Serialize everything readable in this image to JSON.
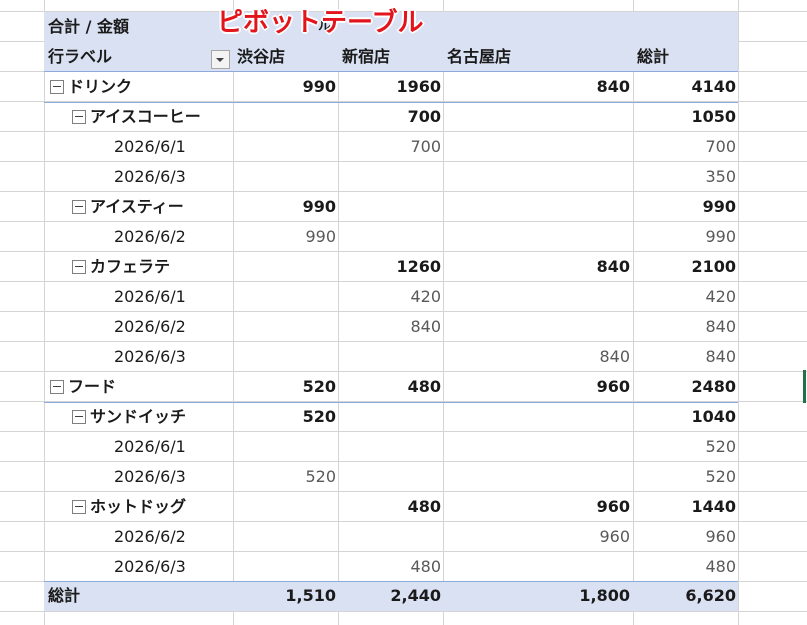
{
  "overlay_title": "ピボットテーブル",
  "header": {
    "value_label": "合計 / 金額",
    "row_label": "行ラベル",
    "col_label_fragment": "ル",
    "columns": [
      "渋谷店",
      "新宿店",
      "名古屋店",
      "総計"
    ]
  },
  "rows": [
    {
      "level": 0,
      "toggle": true,
      "label": "ドリンク",
      "bold": true,
      "values": [
        "990",
        "1960",
        "840",
        "4140"
      ]
    },
    {
      "level": 1,
      "toggle": true,
      "label": "アイスコーヒー",
      "bold": true,
      "values": [
        "",
        "700",
        "",
        "1050"
      ]
    },
    {
      "level": 2,
      "toggle": false,
      "label": "2026/6/1",
      "bold": false,
      "values": [
        "",
        "700",
        "",
        "700"
      ]
    },
    {
      "level": 2,
      "toggle": false,
      "label": "2026/6/3",
      "bold": false,
      "values": [
        "",
        "",
        "",
        "350"
      ]
    },
    {
      "level": 1,
      "toggle": true,
      "label": "アイスティー",
      "bold": true,
      "values": [
        "990",
        "",
        "",
        "990"
      ]
    },
    {
      "level": 2,
      "toggle": false,
      "label": "2026/6/2",
      "bold": false,
      "values": [
        "990",
        "",
        "",
        "990"
      ]
    },
    {
      "level": 1,
      "toggle": true,
      "label": "カフェラテ",
      "bold": true,
      "values": [
        "",
        "1260",
        "840",
        "2100"
      ]
    },
    {
      "level": 2,
      "toggle": false,
      "label": "2026/6/1",
      "bold": false,
      "values": [
        "",
        "420",
        "",
        "420"
      ]
    },
    {
      "level": 2,
      "toggle": false,
      "label": "2026/6/2",
      "bold": false,
      "values": [
        "",
        "840",
        "",
        "840"
      ]
    },
    {
      "level": 2,
      "toggle": false,
      "label": "2026/6/3",
      "bold": false,
      "values": [
        "",
        "",
        "840",
        "840"
      ]
    },
    {
      "level": 0,
      "toggle": true,
      "label": "フード",
      "bold": true,
      "values": [
        "520",
        "480",
        "960",
        "2480"
      ]
    },
    {
      "level": 1,
      "toggle": true,
      "label": "サンドイッチ",
      "bold": true,
      "values": [
        "520",
        "",
        "",
        "1040"
      ]
    },
    {
      "level": 2,
      "toggle": false,
      "label": "2026/6/1",
      "bold": false,
      "values": [
        "",
        "",
        "",
        "520"
      ]
    },
    {
      "level": 2,
      "toggle": false,
      "label": "2026/6/3",
      "bold": false,
      "values": [
        "520",
        "",
        "",
        "520"
      ]
    },
    {
      "level": 1,
      "toggle": true,
      "label": "ホットドッグ",
      "bold": true,
      "values": [
        "",
        "480",
        "960",
        "1440"
      ]
    },
    {
      "level": 2,
      "toggle": false,
      "label": "2026/6/2",
      "bold": false,
      "values": [
        "",
        "",
        "960",
        "960"
      ]
    },
    {
      "level": 2,
      "toggle": false,
      "label": "2026/6/3",
      "bold": false,
      "values": [
        "",
        "480",
        "",
        "480"
      ]
    }
  ],
  "grand_total": {
    "label": "総計",
    "values": [
      "1,510",
      "2,440",
      "1,800",
      "6,620"
    ]
  },
  "colors": {
    "header_band": "#d9e1f2",
    "overlay_title": "#e2151c",
    "grid": "#d4d4d4",
    "selection": "#217346"
  }
}
